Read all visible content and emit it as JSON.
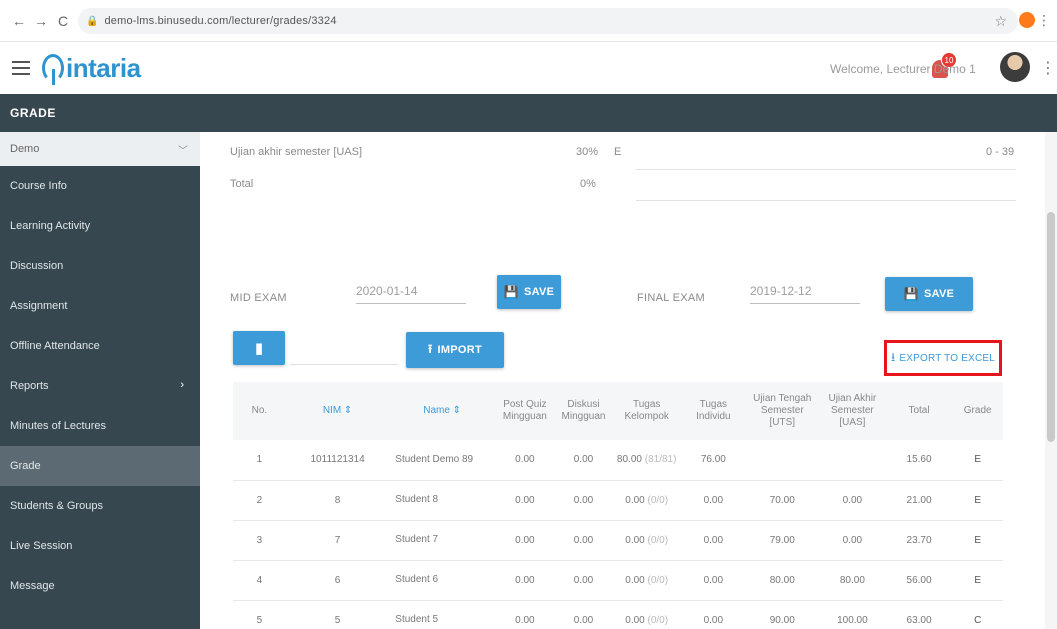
{
  "browser": {
    "url": "demo-lms.binusedu.com/lecturer/grades/3324",
    "nav_back": "←",
    "nav_forward": "→",
    "nav_reload": "C"
  },
  "header": {
    "logo_text": "intaria",
    "notification_count": "10",
    "welcome_text": "Welcome, Lecturer Demo 1"
  },
  "page": {
    "title": "GRADE"
  },
  "sidebar": {
    "course": "Demo",
    "items": [
      {
        "label": "Course Info"
      },
      {
        "label": "Learning Activity"
      },
      {
        "label": "Discussion"
      },
      {
        "label": "Assignment"
      },
      {
        "label": "Offline Attendance"
      },
      {
        "label": "Reports"
      },
      {
        "label": "Minutes of Lectures"
      },
      {
        "label": "Grade"
      },
      {
        "label": "Students & Groups"
      },
      {
        "label": "Live Session"
      },
      {
        "label": "Message"
      }
    ]
  },
  "weights": {
    "uas_label": "Ujian akhir semester [UAS]",
    "uas_value": "30%",
    "uas_grade": "E",
    "uas_right": "0 - 39",
    "total_label": "Total",
    "total_value": "0%"
  },
  "exams": {
    "mid_label": "MID EXAM",
    "mid_date": "2020-01-14",
    "final_label": "FINAL EXAM",
    "final_date": "2019-12-12",
    "save_label": "SAVE"
  },
  "import": {
    "label": "IMPORT"
  },
  "export": {
    "label": "EXPORT TO EXCEL"
  },
  "table": {
    "headers": {
      "no": "No.",
      "nim": "NIM ⇕",
      "name": "Name ⇕",
      "post_quiz": "Post Quiz Mingguan",
      "diskusi": "Diskusi Mingguan",
      "tugas_kel": "Tugas Kelompok",
      "tugas_ind": "Tugas Individu",
      "uts": "Ujian Tengah Semester [UTS]",
      "uas": "Ujian Akhir Semester [UAS]",
      "total": "Total",
      "grade": "Grade"
    },
    "rows": [
      {
        "no": "1",
        "nim": "1011121314",
        "name": "Student Demo 89",
        "pq": "0.00",
        "dis": "0.00",
        "tk": "80.00",
        "tk_note": "(81/81)",
        "ti": "76.00",
        "uts": "",
        "uas": "",
        "total": "15.60",
        "grade": "E"
      },
      {
        "no": "2",
        "nim": "8",
        "name": "Student 8",
        "pq": "0.00",
        "dis": "0.00",
        "tk": "0.00",
        "tk_note": "(0/0)",
        "ti": "0.00",
        "uts": "70.00",
        "uas": "0.00",
        "total": "21.00",
        "grade": "E"
      },
      {
        "no": "3",
        "nim": "7",
        "name": "Student 7",
        "pq": "0.00",
        "dis": "0.00",
        "tk": "0.00",
        "tk_note": "(0/0)",
        "ti": "0.00",
        "uts": "79.00",
        "uas": "0.00",
        "total": "23.70",
        "grade": "E"
      },
      {
        "no": "4",
        "nim": "6",
        "name": "Student 6",
        "pq": "0.00",
        "dis": "0.00",
        "tk": "0.00",
        "tk_note": "(0/0)",
        "ti": "0.00",
        "uts": "80.00",
        "uas": "80.00",
        "total": "56.00",
        "grade": "E"
      },
      {
        "no": "5",
        "nim": "5",
        "name": "Student 5",
        "pq": "0.00",
        "dis": "0.00",
        "tk": "0.00",
        "tk_note": "(0/0)",
        "ti": "0.00",
        "uts": "90.00",
        "uas": "100.00",
        "total": "63.00",
        "grade": "C"
      }
    ]
  }
}
